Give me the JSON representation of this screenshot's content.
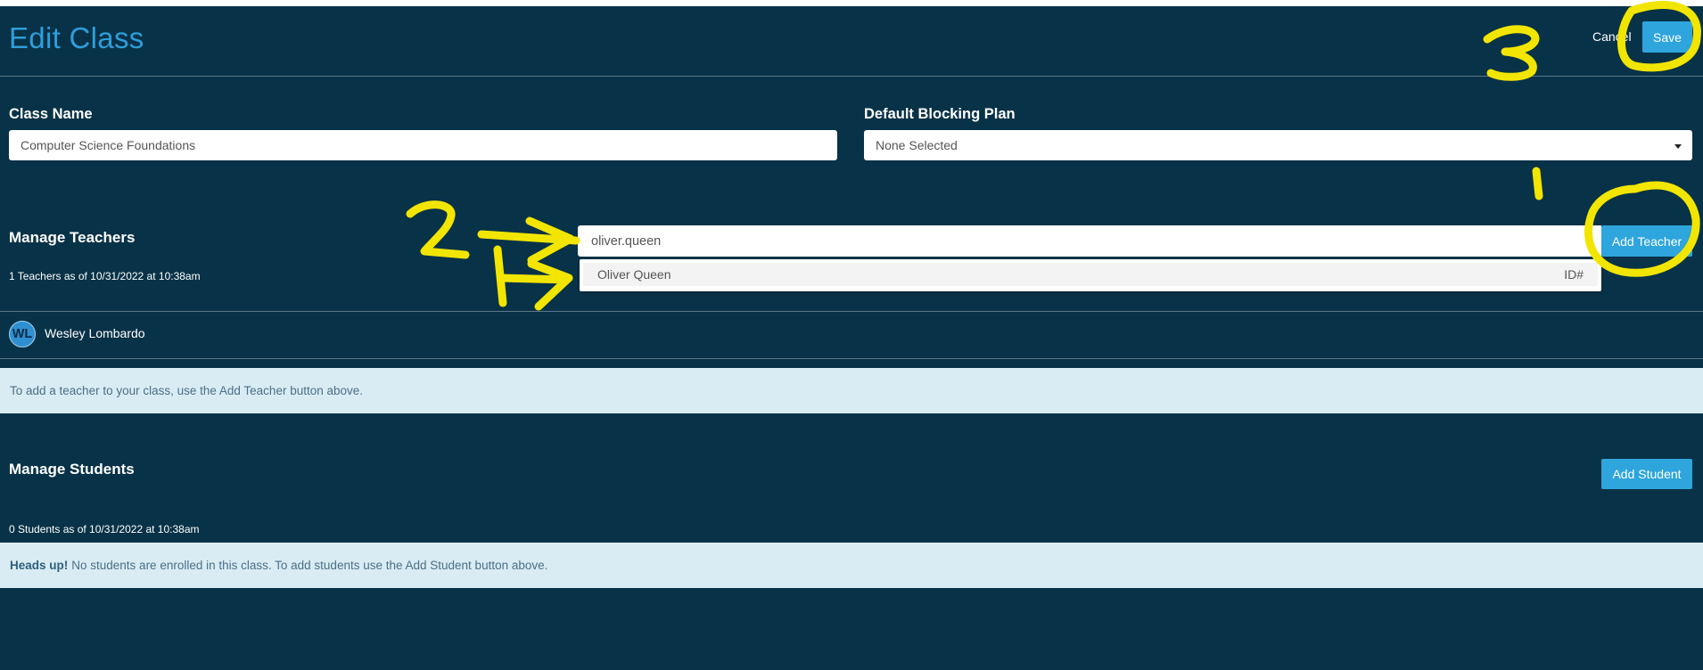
{
  "header": {
    "title": "Edit Class",
    "cancel_label": "Cancel",
    "save_label": "Save"
  },
  "form": {
    "class_name": {
      "label": "Class Name",
      "value": "Computer Science Foundations"
    },
    "blocking_plan": {
      "label": "Default Blocking Plan",
      "value": "None Selected"
    }
  },
  "teachers": {
    "title": "Manage Teachers",
    "count_text": "1 Teachers as of 10/31/2022 at 10:38am",
    "search_value": "oliver.queen",
    "add_label": "Add Teacher",
    "suggestion": {
      "name": "Oliver Queen",
      "id_label": "ID#"
    },
    "list": [
      {
        "initials": "WL",
        "name": "Wesley Lombardo"
      }
    ],
    "info_text": "To add a teacher to your class, use the Add Teacher button above."
  },
  "students": {
    "title": "Manage Students",
    "add_label": "Add Student",
    "count_text": "0 Students as of 10/31/2022 at 10:38am",
    "alert_strong": "Heads up!",
    "alert_text": "No students are enrolled in this class. To add students use the Add Student button above."
  },
  "annotations": {
    "marker_color": "#f2e500"
  },
  "colors": {
    "background": "#083247",
    "accent": "#2ea5dc",
    "info_band": "#d9ecf4"
  }
}
